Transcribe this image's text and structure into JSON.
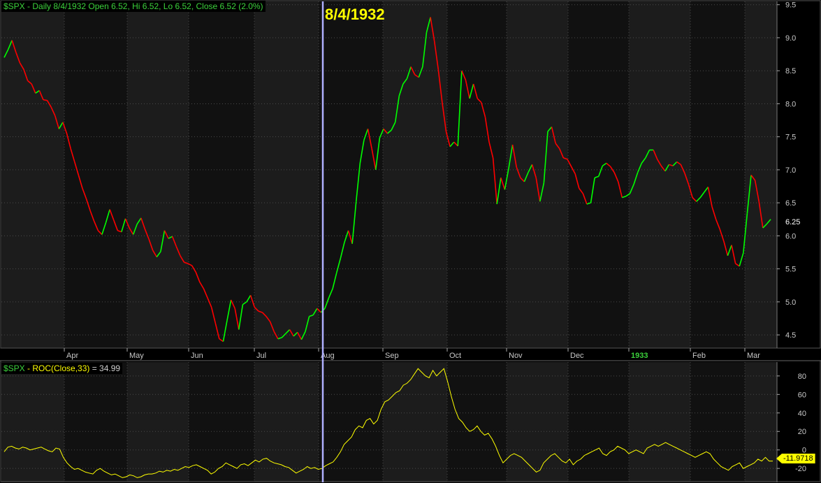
{
  "price_panel": {
    "legend_symbol": "$SPX",
    "legend_text": " - Daily 8/4/1932 Open 6.52, Hi 6.52, Lo 6.52, Close 6.52 (2.0%)",
    "selected_date_label": "8/4/1932",
    "last_price_label": "6.25"
  },
  "roc_panel": {
    "legend_symbol": "$SPX",
    "legend_name": " - ROC(Close,33)",
    "legend_value": " = 34.99",
    "last_value_label": "-11.9718"
  },
  "colors": {
    "background": "#000000",
    "up_bar": "#00ff00",
    "down_bar": "#ff0000",
    "roc_line": "#ffff00",
    "cursor": "#b0b0ff",
    "grid": "#4a4a4a",
    "band_alt": "#1c1c1c"
  },
  "chart_data": [
    {
      "type": "line",
      "title": "$SPX - Daily 8/4/1932 Open 6.52, Hi 6.52, Lo 6.52, Close 6.52 (2.0%)",
      "y_ticks": [
        "9.5",
        "9.0",
        "8.5",
        "8.0",
        "7.5",
        "7.0",
        "6.5",
        "6.0",
        "5.5",
        "5.0",
        "4.5"
      ],
      "ylim": [
        4.3,
        9.55
      ],
      "x_ticks": [
        "Apr",
        "May",
        "Jun",
        "Jul",
        "Aug",
        "Sep",
        "Oct",
        "Nov",
        "Dec",
        "1933",
        "Feb",
        "Mar"
      ],
      "grid": true,
      "series": [
        {
          "values": [
            8.7,
            8.82,
            8.96,
            8.78,
            8.62,
            8.52,
            8.35,
            8.3,
            8.16,
            8.2,
            8.06,
            8.05,
            7.95,
            7.82,
            7.62,
            7.72,
            7.55,
            7.32,
            7.12,
            6.92,
            6.72,
            6.56,
            6.38,
            6.22,
            6.08,
            6.02,
            6.2,
            6.4,
            6.24,
            6.08,
            6.06,
            6.26,
            6.12,
            6.02,
            6.18,
            6.27,
            6.1,
            5.95,
            5.78,
            5.68,
            5.76,
            6.08,
            5.96,
            5.99,
            5.84,
            5.7,
            5.6,
            5.58,
            5.55,
            5.45,
            5.3,
            5.2,
            5.06,
            4.92,
            4.68,
            4.44,
            4.4,
            4.72,
            5.03,
            4.9,
            4.58,
            4.96,
            5.0,
            5.1,
            4.92,
            4.86,
            4.84,
            4.78,
            4.7,
            4.55,
            4.44,
            4.46,
            4.52,
            4.58,
            4.48,
            4.54,
            4.43,
            4.55,
            4.78,
            4.8,
            4.9,
            4.84,
            4.9,
            5.06,
            5.2,
            5.44,
            5.66,
            5.9,
            6.08,
            5.88,
            6.52,
            7.1,
            7.45,
            7.62,
            7.32,
            7.0,
            7.48,
            7.62,
            7.55,
            7.6,
            7.72,
            8.12,
            8.3,
            8.38,
            8.56,
            8.44,
            8.4,
            8.56,
            9.08,
            9.31,
            8.95,
            8.52,
            8.02,
            7.58,
            7.35,
            7.42,
            7.36,
            8.5,
            8.36,
            8.08,
            8.3,
            8.08,
            8.02,
            7.8,
            7.42,
            7.18,
            6.48,
            6.88,
            6.7,
            7.02,
            7.38,
            7.04,
            6.88,
            6.82,
            6.96,
            7.08,
            6.88,
            6.52,
            6.8,
            7.58,
            7.65,
            7.4,
            7.32,
            7.18,
            7.16,
            7.05,
            6.94,
            6.72,
            6.64,
            6.48,
            6.5,
            6.88,
            6.9,
            7.06,
            7.1,
            7.05,
            6.96,
            6.82,
            6.58,
            6.6,
            6.64,
            6.78,
            6.96,
            7.1,
            7.18,
            7.3,
            7.3,
            7.16,
            7.06,
            6.98,
            7.08,
            7.06,
            7.12,
            7.08,
            6.95,
            6.78,
            6.58,
            6.52,
            6.58,
            6.66,
            6.74,
            6.44,
            6.25,
            6.1,
            5.92,
            5.7,
            5.86,
            5.58,
            5.54,
            5.74,
            6.34,
            6.92,
            6.84,
            6.52,
            6.12,
            6.18,
            6.25
          ]
        }
      ]
    },
    {
      "type": "line",
      "title": "$SPX - ROC(Close,33) = 34.99",
      "y_ticks": [
        "80",
        "60",
        "40",
        "20",
        "0",
        "-20"
      ],
      "ylim": [
        -35,
        95
      ],
      "grid": true,
      "series": [
        {
          "values": [
            -2,
            3,
            4,
            2,
            1,
            3,
            2,
            0,
            1,
            2,
            3,
            1,
            -1,
            -2,
            2,
            1,
            -8,
            -14,
            -18,
            -21,
            -20,
            -22,
            -24,
            -25,
            -26,
            -22,
            -20,
            -23,
            -25,
            -27,
            -26,
            -28,
            -30,
            -29,
            -27,
            -28,
            -30,
            -29,
            -27,
            -26,
            -26,
            -25,
            -23,
            -24,
            -22,
            -23,
            -21,
            -22,
            -20,
            -18,
            -19,
            -17,
            -16,
            -18,
            -20,
            -22,
            -26,
            -24,
            -20,
            -18,
            -14,
            -16,
            -18,
            -20,
            -16,
            -15,
            -17,
            -14,
            -11,
            -13,
            -10,
            -9,
            -12,
            -14,
            -15,
            -16,
            -18,
            -19,
            -22,
            -25,
            -23,
            -21,
            -18,
            -20,
            -19,
            -21,
            -20,
            -17,
            -15,
            -13,
            -8,
            -2,
            6,
            10,
            14,
            22,
            26,
            24,
            32,
            34,
            28,
            32,
            44,
            52,
            54,
            58,
            62,
            64,
            70,
            72,
            76,
            82,
            88,
            84,
            80,
            78,
            86,
            80,
            84,
            88,
            74,
            58,
            44,
            34,
            30,
            24,
            20,
            22,
            26,
            20,
            16,
            18,
            12,
            4,
            -6,
            -14,
            -10,
            -6,
            -4,
            -6,
            -8,
            -12,
            -16,
            -20,
            -24,
            -22,
            -14,
            -10,
            -6,
            -4,
            -8,
            -12,
            -14,
            -10,
            -16,
            -12,
            -10,
            -6,
            -4,
            -2,
            0,
            2,
            -4,
            -6,
            -2,
            0,
            4,
            2,
            0,
            -4,
            -2,
            0,
            -2,
            -4,
            2,
            4,
            6,
            4,
            6,
            8,
            6,
            4,
            2,
            0,
            -2,
            -4,
            -6,
            -8,
            -6,
            -4,
            -2,
            -4,
            -10,
            -14,
            -18,
            -20,
            -22,
            -18,
            -16,
            -14,
            -20,
            -18,
            -16,
            -14,
            -10,
            -12,
            -8,
            -12,
            -12
          ]
        }
      ]
    }
  ]
}
